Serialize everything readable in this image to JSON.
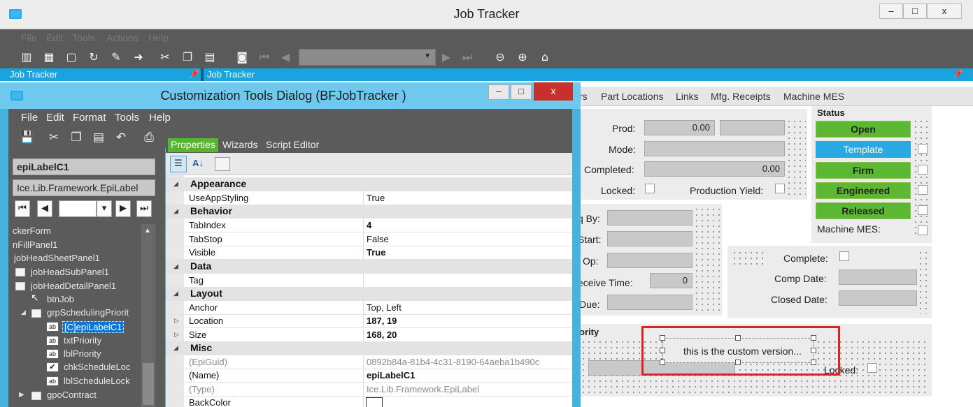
{
  "main_window": {
    "title": "Job Tracker",
    "controls": {
      "minimize": "–",
      "maximize": "□",
      "close": "x"
    },
    "menu": [
      "File",
      "Edit",
      "Tools",
      "Actions",
      "Help"
    ],
    "tabs": [
      "Job Tracker",
      "Job Tracker"
    ],
    "toolbar_icons": [
      "open-icon",
      "grid-icon",
      "new-icon",
      "refresh-icon",
      "clear-icon",
      "next-icon",
      "cut-icon",
      "copy-icon",
      "paste-icon",
      "binoculars-icon",
      "first-record-icon",
      "prev-record-icon",
      "next-record-icon",
      "last-record-icon",
      "back-icon",
      "forward-icon",
      "home-icon"
    ]
  },
  "background_form": {
    "tabs": [
      "rs",
      "Part Locations",
      "Links",
      "Mfg. Receipts",
      "Machine MES"
    ],
    "fields": {
      "prod_label": "Prod:",
      "prod_value": "0.00",
      "mode_label": "Mode:",
      "completed_label": "Completed:",
      "completed_value": "0.00",
      "locked_label": "Locked:",
      "production_yield_label": "Production Yield:",
      "req_by_label": "q By:",
      "start_label": "Start:",
      "op_label": "l Op:",
      "receive_time_label": "eceive Time:",
      "receive_time_value": "0",
      "due_label": "Due:",
      "complete_label": "Complete:",
      "comp_date_label": "Comp Date:",
      "closed_date_label": "Closed Date:",
      "priority_group": "ority",
      "custom_label": "this is the custom version...",
      "locked2_label": "Locked:"
    },
    "status": {
      "title": "Status",
      "buttons": [
        "Open",
        "Template",
        "Firm",
        "Engineered",
        "Released"
      ],
      "machine_mes_label": "Machine MES:"
    },
    "colors": {
      "green": "#5cb832",
      "blue": "#29a9e4",
      "highlight_red": "#d6252a"
    }
  },
  "dialog": {
    "title": "Customization Tools Dialog  (BFJobTracker )",
    "controls": {
      "minimize": "–",
      "maximize": "□",
      "close": "x"
    },
    "menu": [
      "File",
      "Edit",
      "Format",
      "Tools",
      "Help"
    ],
    "toolbar_icons": [
      "save-icon",
      "cut-icon",
      "copy-icon",
      "paste-icon",
      "undo-icon",
      "print-icon",
      "copy2-icon",
      "help-icon"
    ],
    "selected_control": "epiLabelC1",
    "control_type": "Ice.Lib.Framework.EpiLabel",
    "tree": [
      {
        "label": "ckerForm",
        "indent": 0
      },
      {
        "label": "nFillPanel1",
        "indent": 0
      },
      {
        "label": "jobHeadSheetPanel1",
        "indent": 0
      },
      {
        "label": "jobHeadSubPanel1",
        "indent": 1
      },
      {
        "label": "jobHeadDetailPanel1",
        "indent": 1
      },
      {
        "label": "btnJob",
        "indent": 2
      },
      {
        "label": "grpSchedulingPriorit",
        "indent": 2
      },
      {
        "label": "[C]epiLabelC1",
        "indent": 3
      },
      {
        "label": "txtPriority",
        "indent": 3
      },
      {
        "label": "lblPriority",
        "indent": 3
      },
      {
        "label": "chkScheduleLoc",
        "indent": 3
      },
      {
        "label": "lblScheduleLock",
        "indent": 3
      },
      {
        "label": "gpoContract",
        "indent": 2
      }
    ],
    "property_tabs": [
      "Properties",
      "Wizards",
      "Script Editor"
    ],
    "property_grid": [
      {
        "type": "category",
        "name": "Appearance"
      },
      {
        "type": "prop",
        "name": "UseAppStyling",
        "value": "True"
      },
      {
        "type": "category",
        "name": "Behavior"
      },
      {
        "type": "prop",
        "name": "TabIndex",
        "value": "4",
        "bold": true
      },
      {
        "type": "prop",
        "name": "TabStop",
        "value": "False"
      },
      {
        "type": "prop",
        "name": "Visible",
        "value": "True",
        "bold": true
      },
      {
        "type": "category",
        "name": "Data"
      },
      {
        "type": "prop",
        "name": "Tag",
        "value": ""
      },
      {
        "type": "category",
        "name": "Layout"
      },
      {
        "type": "prop",
        "name": "Anchor",
        "value": "Top, Left"
      },
      {
        "type": "prop",
        "name": "Location",
        "value": "187, 19",
        "bold": true,
        "expandable": true
      },
      {
        "type": "prop",
        "name": "Size",
        "value": "168, 20",
        "bold": true,
        "expandable": true
      },
      {
        "type": "category",
        "name": "Misc"
      },
      {
        "type": "prop",
        "name": "(EpiGuid)",
        "value": "0892b84a-81b4-4c31-8190-64aeba1b490c",
        "grey": true
      },
      {
        "type": "prop",
        "name": "(Name)",
        "value": "epiLabelC1",
        "bold": true
      },
      {
        "type": "prop",
        "name": "(Type)",
        "value": "Ice.Lib.Framework.EpiLabel",
        "grey": true
      },
      {
        "type": "prop",
        "name": "BackColor",
        "value": ""
      }
    ]
  }
}
